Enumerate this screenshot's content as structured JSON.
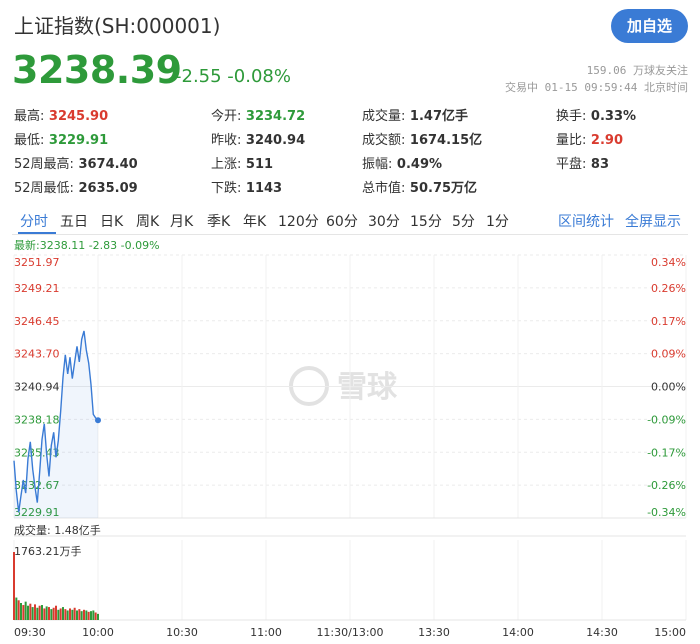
{
  "header": {
    "title": "上证指数(SH:000001)",
    "add_button": "加自选",
    "price": "3238.39",
    "change": "-2.55 -0.08%",
    "followers": "159.06 万球友关注",
    "status": "交易中 01-15 09:59:44 北京时间"
  },
  "stats": [
    {
      "label": "最高:",
      "value": "3245.90",
      "color": "red"
    },
    {
      "label": "今开:",
      "value": "3234.72",
      "color": "green"
    },
    {
      "label": "成交量:",
      "value": "1.47亿手",
      "color": ""
    },
    {
      "label": "换手:",
      "value": "0.33%",
      "color": ""
    },
    {
      "label": "最低:",
      "value": "3229.91",
      "color": "green"
    },
    {
      "label": "昨收:",
      "value": "3240.94",
      "color": ""
    },
    {
      "label": "成交额:",
      "value": "1674.15亿",
      "color": ""
    },
    {
      "label": "量比:",
      "value": "2.90",
      "color": "red"
    },
    {
      "label": "52周最高:",
      "value": "3674.40",
      "color": ""
    },
    {
      "label": "上涨:",
      "value": "511",
      "color": ""
    },
    {
      "label": "振幅:",
      "value": "0.49%",
      "color": ""
    },
    {
      "label": "平盘:",
      "value": "83",
      "color": ""
    },
    {
      "label": "52周最低:",
      "value": "2635.09",
      "color": ""
    },
    {
      "label": "下跌:",
      "value": "1143",
      "color": ""
    },
    {
      "label": "总市值:",
      "value": "50.75万亿",
      "color": ""
    }
  ],
  "tabs": [
    "分时",
    "五日",
    "日K",
    "周K",
    "月K",
    "季K",
    "年K",
    "120分",
    "60分",
    "30分",
    "15分",
    "5分",
    "1分"
  ],
  "active_tab": "分时",
  "right_tabs": [
    "区间统计",
    "全屏显示"
  ],
  "chart_header": "最新:3238.11 -2.83 -0.09%",
  "watermark": "雪球",
  "volume_label": "成交量: 1.48亿手",
  "volume_max": "1763.21万手",
  "colors": {
    "up": "#d93b2f",
    "down": "#2e9a3a",
    "accent": "#3a7bd5",
    "line": "#3a7bd5"
  },
  "chart_data": {
    "type": "line",
    "y_ticks": [
      "3251.97",
      "3249.21",
      "3246.45",
      "3243.70",
      "3240.94",
      "3238.18",
      "3235.43",
      "3232.67",
      "3229.91"
    ],
    "pct_ticks": [
      "0.34%",
      "0.26%",
      "0.17%",
      "0.09%",
      "0.00%",
      "-0.09%",
      "-0.17%",
      "-0.26%",
      "-0.34%"
    ],
    "x_ticks": [
      "09:30",
      "10:00",
      "10:30",
      "11:00",
      "11:30/13:00",
      "13:30",
      "14:00",
      "14:30",
      "15:00"
    ],
    "ylim": [
      3229.91,
      3251.97
    ],
    "prev_close": 3240.94,
    "price": [
      3234.72,
      3232.2,
      3230.4,
      3231.8,
      3233.1,
      3232.0,
      3234.9,
      3236.3,
      3234.0,
      3232.5,
      3231.2,
      3233.8,
      3236.5,
      3237.8,
      3235.2,
      3233.4,
      3236.0,
      3237.1,
      3235.0,
      3236.4,
      3238.9,
      3241.7,
      3243.6,
      3242.0,
      3243.4,
      3241.6,
      3243.0,
      3244.3,
      3243.0,
      3244.9,
      3245.6,
      3244.0,
      3242.9,
      3241.1,
      3238.6,
      3238.3,
      3238.11
    ],
    "volume": [
      100,
      33,
      29,
      25,
      22,
      27,
      21,
      24,
      19,
      23,
      18,
      21,
      22,
      17,
      20,
      19,
      16,
      18,
      21,
      15,
      17,
      19,
      16,
      14,
      17,
      15,
      18,
      14,
      16,
      13,
      15,
      14,
      12,
      13,
      14,
      11,
      9
    ],
    "volume_dir": [
      "up",
      "down",
      "up",
      "down",
      "up",
      "down",
      "down",
      "up",
      "down",
      "up",
      "down",
      "up",
      "down",
      "up",
      "down",
      "up",
      "down",
      "up",
      "up",
      "down",
      "up",
      "down",
      "up",
      "down",
      "up",
      "down",
      "up",
      "down",
      "up",
      "down",
      "up",
      "down",
      "up",
      "down",
      "down",
      "up",
      "down"
    ]
  }
}
